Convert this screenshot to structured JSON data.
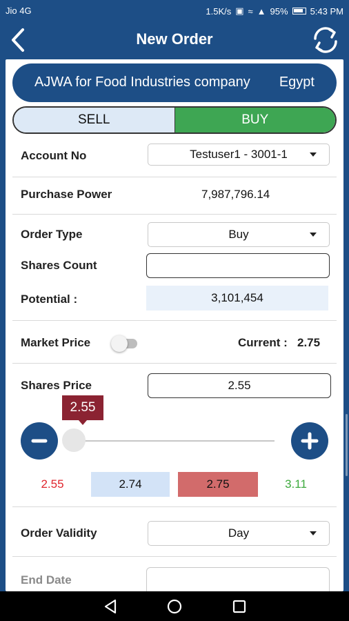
{
  "status_bar": {
    "carrier": "Jio 4G",
    "speed": "1.5K/s",
    "battery": "95%",
    "time": "5:43 PM"
  },
  "app_bar": {
    "title": "New Order",
    "back_icon": "back-arrow-icon",
    "refresh_icon": "refresh-icon"
  },
  "company": {
    "name": "AJWA for Food Industries company",
    "country": "Egypt"
  },
  "side_toggle": {
    "sell_label": "SELL",
    "buy_label": "BUY",
    "selected": "BUY",
    "buy_color": "#3ea653",
    "sell_color": "#dde9f6"
  },
  "form": {
    "account_label": "Account No",
    "account_value": "Testuser1 - 3001-1",
    "purchase_power_label": "Purchase Power",
    "purchase_power_value": "7,987,796.14",
    "order_type_label": "Order Type",
    "order_type_value": "Buy",
    "shares_count_label": "Shares Count",
    "shares_count_value": "",
    "potential_label": "Potential :",
    "potential_value": "3,101,454",
    "market_price_label": "Market Price",
    "market_price_enabled": false,
    "current_label": "Current :",
    "current_value": "2.75",
    "shares_price_label": "Shares Price",
    "shares_price_value": "2.55",
    "order_validity_label": "Order Validity",
    "order_validity_value": "Day",
    "end_date_label": "End Date",
    "end_date_value": ""
  },
  "price_slider": {
    "tooltip_value": "2.55",
    "minus_icon": "minus-icon",
    "plus_icon": "plus-icon",
    "position_fraction": 0,
    "min_price": "2.55",
    "bid_price": "2.74",
    "ask_price": "2.75",
    "max_price": "3.11",
    "colors": {
      "min": "#e0252d",
      "bid_bg": "#d3e3f7",
      "ask_bg": "#d26b6b",
      "max": "#3eaa3e"
    }
  },
  "nav_bar": {
    "back_icon": "nav-back-icon",
    "home_icon": "nav-home-icon",
    "recents_icon": "nav-recents-icon"
  }
}
